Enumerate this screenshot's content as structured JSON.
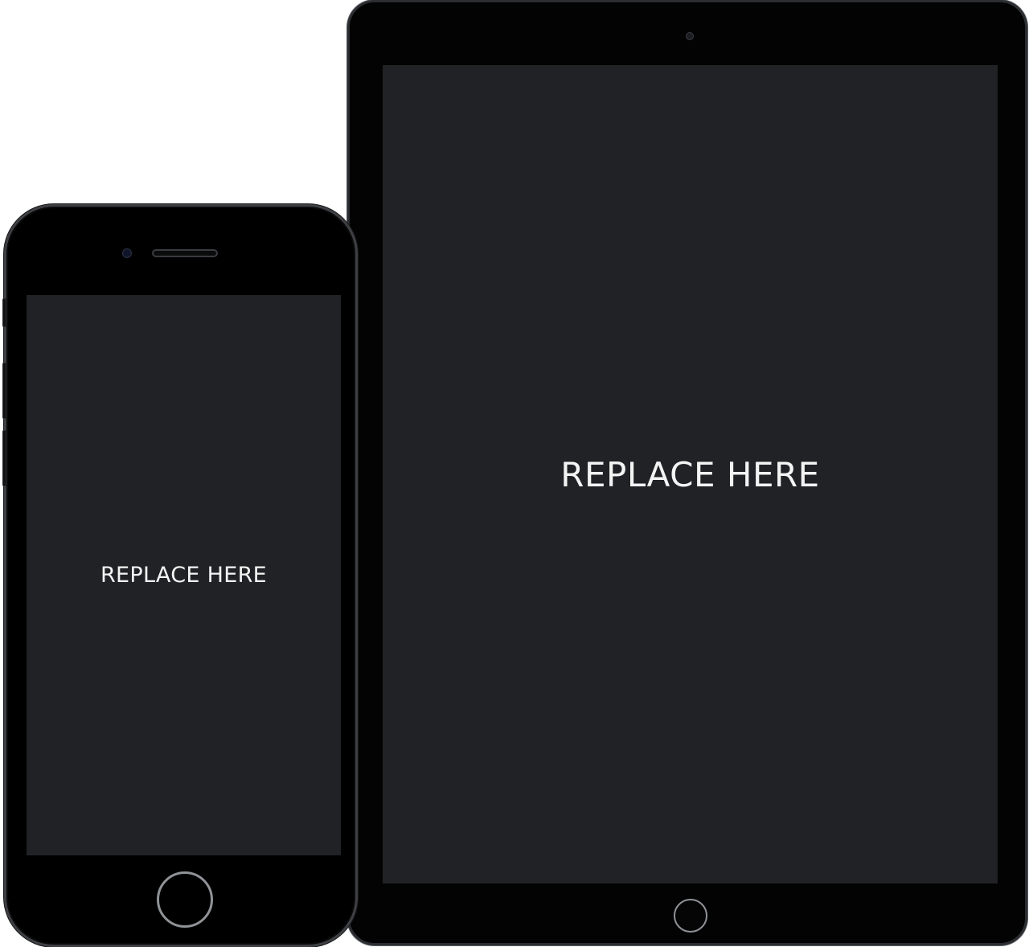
{
  "tablet": {
    "screen_label": "REPLACE HERE"
  },
  "phone": {
    "screen_label": "REPLACE HERE"
  },
  "colors": {
    "background": "#ffffff",
    "device_body": "#030303",
    "screen": "#212226",
    "label_text": "#f4f4f4",
    "home_ring": "#8f9297"
  }
}
